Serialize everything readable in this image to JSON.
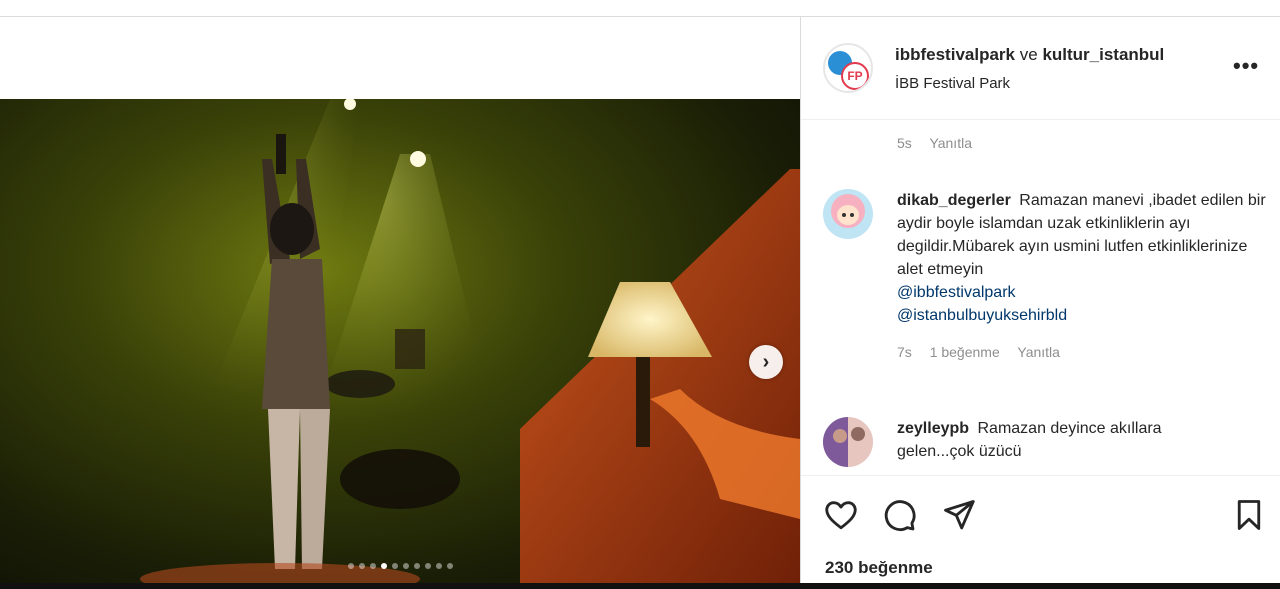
{
  "post": {
    "header": {
      "account_primary": "ibbfestivalpark",
      "joiner": "ve",
      "account_secondary": "kultur_istanbul",
      "location": "İBB Festival Park",
      "more_icon": "more-horizontal-icon"
    },
    "media": {
      "next_icon": "chevron-right-icon",
      "carousel": {
        "total": 10,
        "active_index": 3
      }
    },
    "comments": {
      "previous_meta": {
        "time": "5s",
        "reply": "Yanıtla"
      },
      "items": [
        {
          "username": "dikab_degerler",
          "text": "Ramazan manevi ,ibadet edilen bir aydir boyle islamdan uzak etkinliklerin ayı degildir.Mübarek ayın usmini lutfen etkinliklerinize alet etmeyin",
          "mentions": [
            "@ibbfestivalpark",
            "@istanbulbuyuksehirbld"
          ],
          "time": "7s",
          "likes": "1 beğenme",
          "reply": "Yanıtla"
        },
        {
          "username": "zeylleypb",
          "text": "Ramazan deyince akıllara gelen...çok üzücü"
        }
      ]
    },
    "actions": {
      "like_icon": "heart-icon",
      "comment_icon": "comment-icon",
      "share_icon": "send-icon",
      "save_icon": "bookmark-icon"
    },
    "like_count": "230 beğenme"
  }
}
